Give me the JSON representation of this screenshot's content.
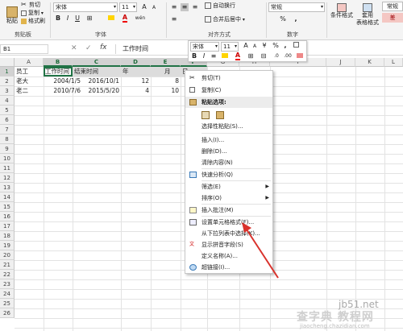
{
  "ribbon": {
    "clipboard": {
      "cut": "剪切",
      "copy": "复制",
      "format_painter": "格式刷",
      "paste": "粘贴",
      "group_label": "剪贴板"
    },
    "font": {
      "font_name": "宋体",
      "font_size": "11",
      "grow": "A",
      "shrink": "A",
      "bold": "B",
      "italic": "I",
      "underline": "U",
      "wen": "wén",
      "group_label": "字体"
    },
    "alignment": {
      "wrap_text": "自动换行",
      "merge_center": "合并后居中",
      "group_label": "对齐方式"
    },
    "number": {
      "format": "常规",
      "percent": "%",
      "comma": ",",
      "group_label": "数字"
    },
    "styles": {
      "conditional": "条件格式",
      "table_format_line1": "套用",
      "table_format_line2": "表格格式",
      "style_normal": "常规",
      "style_bad": "差"
    }
  },
  "formula_bar": {
    "name_box": "B1",
    "fx": "fx",
    "content": "工作时间",
    "cancel": "✕",
    "confirm": "✓"
  },
  "columns": [
    "A",
    "B",
    "C",
    "D",
    "E",
    "F",
    "G",
    "H",
    "I",
    "J",
    "K",
    "L"
  ],
  "rows": [
    "1",
    "2",
    "3",
    "4",
    "5",
    "6",
    "7",
    "8",
    "9",
    "10",
    "11",
    "12",
    "13",
    "14",
    "15",
    "16",
    "17",
    "18",
    "19",
    "20",
    "21",
    "22",
    "23",
    "24",
    "25",
    "26"
  ],
  "cells": {
    "a1": "员工",
    "b1": "工作时间",
    "c1": "结束时间",
    "d1": "年",
    "e1": "月",
    "f1": "日",
    "a2": "老大",
    "b2": "2004/1/5",
    "c2": "2016/10/1",
    "d2": "12",
    "e2": "8",
    "a3": "老二",
    "b3": "2010/7/6",
    "c3": "2015/5/20",
    "d3": "4",
    "e3": "10"
  },
  "mini_toolbar": {
    "font_name": "宋体",
    "font_size": "11",
    "grow": "A",
    "shrink": "A",
    "currency": "¥",
    "percent": "%",
    "comma": ",",
    "bold": "B",
    "italic": "I",
    "align": "≡"
  },
  "context_menu": {
    "cut": "剪切(T)",
    "copy": "复制(C)",
    "paste_options": "粘贴选项:",
    "paste_special": "选择性粘贴(S)...",
    "insert": "插入(I)...",
    "delete": "删除(D)...",
    "clear": "清除内容(N)",
    "quick_analysis": "快速分析(Q)",
    "filter": "筛选(E)",
    "sort": "排序(O)",
    "insert_comment": "插入批注(M)",
    "format_cells": "设置单元格格式(F)...",
    "pick_list": "从下拉列表中选择(K)...",
    "phonetic": "显示拼音字段(S)",
    "define_name": "定义名称(A)...",
    "hyperlink": "超链接(I)..."
  },
  "watermark": {
    "line1": "jb51.net",
    "line2": "查字典 教程网",
    "line3": "jiaocheng.chazidian.com"
  },
  "colors": {
    "excel_green": "#217346",
    "red_arrow": "#d9322c",
    "cond_red": "#f4c7c3"
  }
}
